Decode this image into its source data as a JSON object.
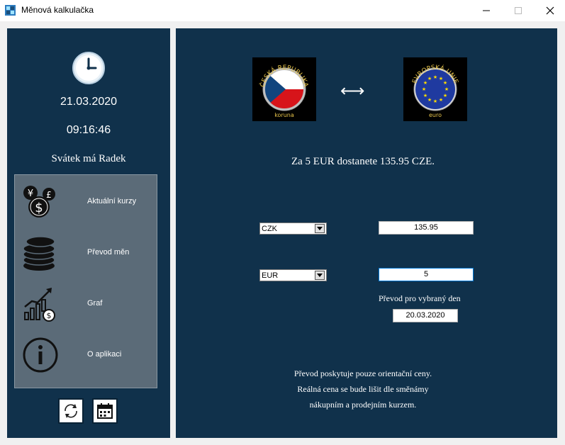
{
  "window": {
    "title": "Měnová kalkulačka"
  },
  "sidebar": {
    "date": "21.03.2020",
    "time": "09:16:46",
    "nameday": "Svátek má Radek",
    "menu": [
      {
        "label": "Aktuální kurzy",
        "icon": "coins-currency-icon"
      },
      {
        "label": "Převod měn",
        "icon": "coin-stack-icon"
      },
      {
        "label": "Graf",
        "icon": "growth-chart-icon"
      },
      {
        "label": "O aplikaci",
        "icon": "info-icon"
      }
    ]
  },
  "main": {
    "flag_left": {
      "top": "ČESKÁ REPUBLIKA",
      "bottom": "koruna"
    },
    "flag_right": {
      "top": "EVROPSKÁ UNIE",
      "bottom": "euro"
    },
    "arrow": "⟷",
    "result": "Za 5 EUR dostanete 135.95 CZE.",
    "from_currency": "CZK",
    "from_amount": "135.95",
    "to_currency": "EUR",
    "to_amount": "5",
    "day_label": "Převod pro vybraný den",
    "day_value": "20.03.2020",
    "note_lines": [
      "Převod poskytuje pouze orientační ceny.",
      "Reálná cena se bude lišit dle směnámy",
      "nákupním a prodejním kurzem."
    ]
  },
  "colors": {
    "panel": "#10314b",
    "menu_bg": "#5b6b78"
  }
}
